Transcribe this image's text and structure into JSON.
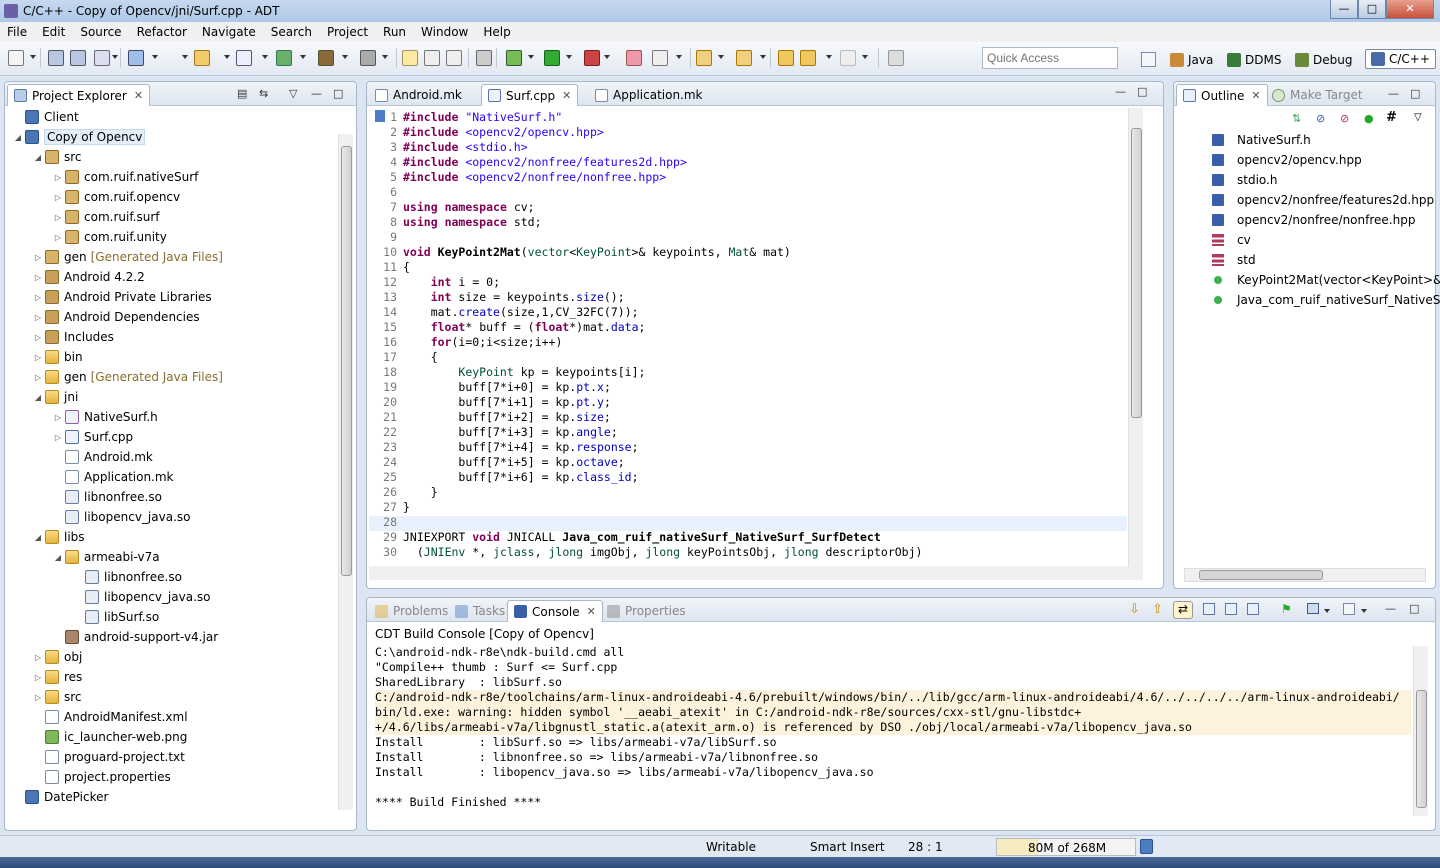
{
  "window": {
    "title": "C/C++ - Copy of Opencv/jni/Surf.cpp - ADT"
  },
  "menubar": [
    "File",
    "Edit",
    "Source",
    "Refactor",
    "Navigate",
    "Search",
    "Project",
    "Run",
    "Window",
    "Help"
  ],
  "quick_access": {
    "placeholder": "Quick Access"
  },
  "perspectives": [
    {
      "label": "Java",
      "icon": "java-perspective-icon"
    },
    {
      "label": "DDMS",
      "icon": "ddms-perspective-icon"
    },
    {
      "label": "Debug",
      "icon": "debug-perspective-icon"
    },
    {
      "label": "C/C++",
      "icon": "cpp-perspective-icon",
      "active": true
    }
  ],
  "project_explorer": {
    "title": "Project Explorer",
    "items": [
      {
        "label": "Client",
        "depth": 0,
        "twisty": "",
        "icon": "proj"
      },
      {
        "label": "Copy of Opencv",
        "depth": 0,
        "twisty": "open",
        "icon": "proj",
        "selected": true
      },
      {
        "label": "src",
        "depth": 1,
        "twisty": "open",
        "icon": "pkg"
      },
      {
        "label": "com.ruif.nativeSurf",
        "depth": 2,
        "twisty": "closed",
        "icon": "pkg"
      },
      {
        "label": "com.ruif.opencv",
        "depth": 2,
        "twisty": "closed",
        "icon": "pkg"
      },
      {
        "label": "com.ruif.surf",
        "depth": 2,
        "twisty": "closed",
        "icon": "pkg"
      },
      {
        "label": "com.ruif.unity",
        "depth": 2,
        "twisty": "closed",
        "icon": "pkg"
      },
      {
        "label": "gen",
        "deco": "[Generated Java Files]",
        "depth": 1,
        "twisty": "closed",
        "icon": "pkg"
      },
      {
        "label": "Android 4.2.2",
        "depth": 1,
        "twisty": "closed",
        "icon": "lib"
      },
      {
        "label": "Android Private Libraries",
        "depth": 1,
        "twisty": "closed",
        "icon": "lib"
      },
      {
        "label": "Android Dependencies",
        "depth": 1,
        "twisty": "closed",
        "icon": "lib"
      },
      {
        "label": "Includes",
        "depth": 1,
        "twisty": "closed",
        "icon": "lib"
      },
      {
        "label": "bin",
        "depth": 1,
        "twisty": "closed",
        "icon": "folder"
      },
      {
        "label": "gen",
        "deco": "[Generated Java Files]",
        "depth": 1,
        "twisty": "closed",
        "icon": "folder"
      },
      {
        "label": "jni",
        "depth": 1,
        "twisty": "open",
        "icon": "folder"
      },
      {
        "label": "NativeSurf.h",
        "depth": 2,
        "twisty": "closed",
        "icon": "hfile"
      },
      {
        "label": "Surf.cpp",
        "depth": 2,
        "twisty": "closed",
        "icon": "cfile"
      },
      {
        "label": "Android.mk",
        "depth": 2,
        "twisty": "",
        "icon": "file"
      },
      {
        "label": "Application.mk",
        "depth": 2,
        "twisty": "",
        "icon": "file"
      },
      {
        "label": "libnonfree.so",
        "depth": 2,
        "twisty": "",
        "icon": "so"
      },
      {
        "label": "libopencv_java.so",
        "depth": 2,
        "twisty": "",
        "icon": "so"
      },
      {
        "label": "libs",
        "depth": 1,
        "twisty": "open",
        "icon": "folder"
      },
      {
        "label": "armeabi-v7a",
        "depth": 2,
        "twisty": "open",
        "icon": "folder"
      },
      {
        "label": "libnonfree.so",
        "depth": 3,
        "twisty": "",
        "icon": "so"
      },
      {
        "label": "libopencv_java.so",
        "depth": 3,
        "twisty": "",
        "icon": "so"
      },
      {
        "label": "libSurf.so",
        "depth": 3,
        "twisty": "",
        "icon": "so"
      },
      {
        "label": "android-support-v4.jar",
        "depth": 2,
        "twisty": "",
        "icon": "jar"
      },
      {
        "label": "obj",
        "depth": 1,
        "twisty": "closed",
        "icon": "folder"
      },
      {
        "label": "res",
        "depth": 1,
        "twisty": "closed",
        "icon": "folder"
      },
      {
        "label": "src",
        "depth": 1,
        "twisty": "closed",
        "icon": "folder"
      },
      {
        "label": "AndroidManifest.xml",
        "depth": 1,
        "twisty": "",
        "icon": "file"
      },
      {
        "label": "ic_launcher-web.png",
        "depth": 1,
        "twisty": "",
        "icon": "img"
      },
      {
        "label": "proguard-project.txt",
        "depth": 1,
        "twisty": "",
        "icon": "file"
      },
      {
        "label": "project.properties",
        "depth": 1,
        "twisty": "",
        "icon": "file"
      },
      {
        "label": "DatePicker",
        "depth": 0,
        "twisty": "",
        "icon": "proj"
      }
    ]
  },
  "editor": {
    "tabs": [
      {
        "label": "Android.mk",
        "active": false
      },
      {
        "label": "Surf.cpp",
        "active": true
      },
      {
        "label": "Application.mk",
        "active": false
      }
    ],
    "line_numbers": [
      "1",
      "2",
      "3",
      "4",
      "5",
      "6",
      "7",
      "8",
      "9",
      "10",
      "11",
      "12",
      "13",
      "14",
      "15",
      "16",
      "17",
      "18",
      "19",
      "20",
      "21",
      "22",
      "23",
      "24",
      "25",
      "26",
      "27",
      "28",
      "29",
      "30"
    ],
    "lines": [
      "#include \"NativeSurf.h\"",
      "#include <opencv2/opencv.hpp>",
      "#include <stdio.h>",
      "#include <opencv2/nonfree/features2d.hpp>",
      "#include <opencv2/nonfree/nonfree.hpp>",
      "",
      "using namespace cv;",
      "using namespace std;",
      "",
      "void KeyPoint2Mat(vector<KeyPoint>& keypoints, Mat& mat)",
      "{",
      "    int i = 0;",
      "    int size = keypoints.size();",
      "    mat.create(size,1,CV_32FC(7));",
      "    float* buff = (float*)mat.data;",
      "    for(i=0;i<size;i++)",
      "    {",
      "        KeyPoint kp = keypoints[i];",
      "        buff[7*i+0] = kp.pt.x;",
      "        buff[7*i+1] = kp.pt.y;",
      "        buff[7*i+2] = kp.size;",
      "        buff[7*i+3] = kp.angle;",
      "        buff[7*i+4] = kp.response;",
      "        buff[7*i+5] = kp.octave;",
      "        buff[7*i+6] = kp.class_id;",
      "    }",
      "}",
      "",
      "JNIEXPORT void JNICALL Java_com_ruif_nativeSurf_NativeSurf_SurfDetect",
      "  (JNIEnv *, jclass, jlong imgObj, jlong keyPointsObj, jlong descriptorObj)"
    ]
  },
  "outline": {
    "title": "Outline",
    "other_tab": "Make Target",
    "items": [
      {
        "label": "NativeSurf.h",
        "kind": "include"
      },
      {
        "label": "opencv2/opencv.hpp",
        "kind": "include"
      },
      {
        "label": "stdio.h",
        "kind": "include"
      },
      {
        "label": "opencv2/nonfree/features2d.hpp",
        "kind": "include"
      },
      {
        "label": "opencv2/nonfree/nonfree.hpp",
        "kind": "include"
      },
      {
        "label": "cv",
        "kind": "namespace"
      },
      {
        "label": "std",
        "kind": "namespace"
      },
      {
        "label": "KeyPoint2Mat(vector<KeyPoint>&",
        "kind": "function"
      },
      {
        "label": "Java_com_ruif_nativeSurf_NativeSu",
        "kind": "function"
      }
    ]
  },
  "console_panel": {
    "tabs": [
      {
        "label": "Problems",
        "active": false
      },
      {
        "label": "Tasks",
        "active": false
      },
      {
        "label": "Console",
        "active": true
      },
      {
        "label": "Properties",
        "active": false
      }
    ],
    "header": "CDT Build Console [Copy of Opencv]",
    "lines": [
      {
        "text": "C:\\android-ndk-r8e\\ndk-build.cmd all",
        "warn": false
      },
      {
        "text": "\"Compile++ thumb : Surf <= Surf.cpp",
        "warn": false
      },
      {
        "text": "SharedLibrary  : libSurf.so",
        "warn": false
      },
      {
        "text": "C:/android-ndk-r8e/toolchains/arm-linux-androideabi-4.6/prebuilt/windows/bin/../lib/gcc/arm-linux-androideabi/4.6/../../../../arm-linux-androideabi/",
        "warn": true
      },
      {
        "text": "bin/ld.exe: warning: hidden symbol '__aeabi_atexit' in C:/android-ndk-r8e/sources/cxx-stl/gnu-libstdc+",
        "warn": true
      },
      {
        "text": "+/4.6/libs/armeabi-v7a/libgnustl_static.a(atexit_arm.o) is referenced by DSO ./obj/local/armeabi-v7a/libopencv_java.so",
        "warn": true
      },
      {
        "text": "Install        : libSurf.so => libs/armeabi-v7a/libSurf.so",
        "warn": false
      },
      {
        "text": "Install        : libnonfree.so => libs/armeabi-v7a/libnonfree.so",
        "warn": false
      },
      {
        "text": "Install        : libopencv_java.so => libs/armeabi-v7a/libopencv_java.so",
        "warn": false
      },
      {
        "text": "",
        "warn": false
      },
      {
        "text": "**** Build Finished ****",
        "warn": false
      }
    ]
  },
  "statusbar": {
    "writable": "Writable",
    "insert_mode": "Smart Insert",
    "position": "28 : 1",
    "heap": "80M of 268M",
    "heap_fraction": 0.3
  }
}
